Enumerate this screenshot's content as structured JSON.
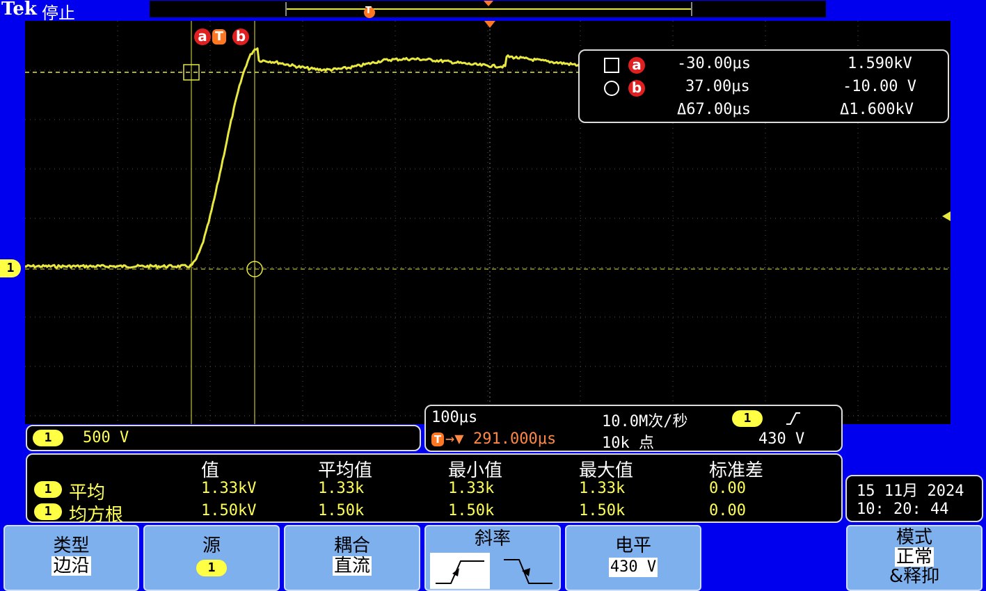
{
  "header": {
    "brand": "Tek",
    "status": "停止",
    "trigger_marker": "T"
  },
  "cursor_flags": {
    "a": "a",
    "t": "T",
    "b": "b"
  },
  "channel_marker": "1",
  "cursor_readout": {
    "rows": [
      {
        "cursor": "a",
        "time": "-30.00μs",
        "value": "1.590kV"
      },
      {
        "cursor": "b",
        "time": "37.00μs",
        "value": "-10.00 V"
      }
    ],
    "delta_time": "Δ67.00μs",
    "delta_value": "Δ1.600kV"
  },
  "channel_scale": {
    "channel": "1",
    "scale": "500 V"
  },
  "timebase": {
    "time_per_div": "100μs",
    "trigger_position": "291.000μs",
    "sample_rate": "10.0M次/秒",
    "record_length": "10k 点",
    "trigger_channel": "1",
    "trigger_level": "430 V"
  },
  "measurements": {
    "headers": [
      "值",
      "平均值",
      "最小值",
      "最大值",
      "标准差"
    ],
    "rows": [
      {
        "channel": "1",
        "name": "平均",
        "value": "1.33kV",
        "mean": "1.33k",
        "min": "1.33k",
        "max": "1.33k",
        "std": "0.00"
      },
      {
        "channel": "1",
        "name": "均方根",
        "value": "1.50kV",
        "mean": "1.50k",
        "min": "1.50k",
        "max": "1.50k",
        "std": "0.00"
      }
    ]
  },
  "datetime": {
    "date": "15 11月  2024",
    "time": "10: 20: 44"
  },
  "softkeys": {
    "type": {
      "label": "类型",
      "value": "边沿"
    },
    "source": {
      "label": "源",
      "value": "1"
    },
    "coupling": {
      "label": "耦合",
      "value": "直流"
    },
    "slope": {
      "label": "斜率"
    },
    "level": {
      "label": "电平",
      "value": "430 V"
    },
    "mode": {
      "label": "模式",
      "value": "正常",
      "value2": "&释抑"
    }
  },
  "colors": {
    "trace": "#e8e840",
    "background": "#0000ee",
    "accent_red": "#e02020",
    "trigger_orange": "#ff7722"
  }
}
